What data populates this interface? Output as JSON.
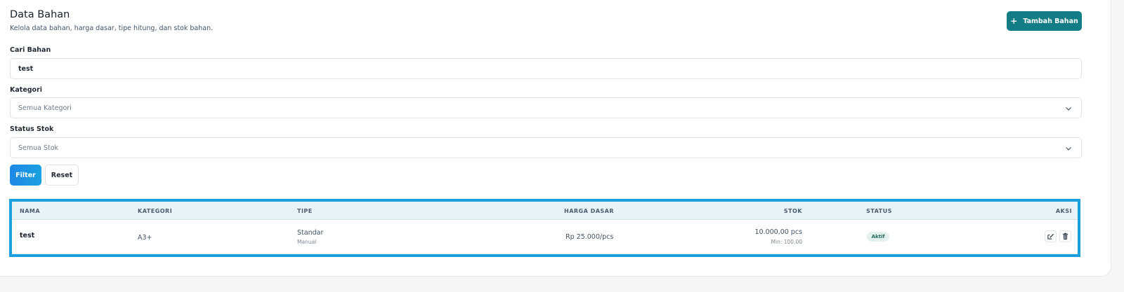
{
  "header": {
    "title": "Data Bahan",
    "subtitle": "Kelola data bahan, harga dasar, tipe hitung, dan stok bahan.",
    "add_button_label": "Tambah Bahan",
    "add_button_icon": "plus-icon"
  },
  "filters": {
    "search": {
      "label": "Cari Bahan",
      "value": "test"
    },
    "category": {
      "label": "Kategori",
      "selected": "Semua Kategori"
    },
    "stock_status": {
      "label": "Status Stok",
      "selected": "Semua Stok"
    },
    "filter_button_label": "Filter",
    "reset_button_label": "Reset"
  },
  "table": {
    "columns": [
      "NAMA",
      "KATEGORI",
      "TIPE",
      "HARGA DASAR",
      "STOK",
      "STATUS",
      "AKSI"
    ],
    "rows": [
      {
        "nama": "test",
        "kategori": "A3+",
        "tipe": "Standar",
        "tipe_sub": "Manual",
        "harga_dasar": "Rp 25.000/pcs",
        "stok": "10.000,00 pcs",
        "stok_min": "Min: 100,00",
        "status": "Aktif",
        "actions": [
          "edit-icon",
          "trash-icon"
        ]
      }
    ]
  },
  "colors": {
    "accent_teal": "#127d86",
    "filter_blue": "#1e88e5",
    "highlight_border": "#1aa0dc",
    "status_active_bg": "#e4f1ee"
  }
}
